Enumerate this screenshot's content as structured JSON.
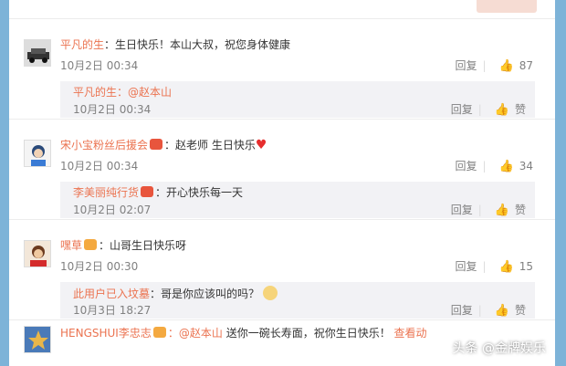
{
  "comments": [
    {
      "user": "平凡的生",
      "text": "：生日快乐！本山大叔，祝您身体健康",
      "date": "10月2日 00:34",
      "reply_label": "回复",
      "likes": "87",
      "reply": {
        "user": "平凡的生",
        "text": "：@赵本山",
        "date": "10月2日 00:34",
        "reply_label": "回复",
        "like_label": "赞"
      }
    },
    {
      "user": "宋小宝粉丝后援会",
      "text": "：赵老师 生日快乐",
      "date": "10月2日 00:34",
      "reply_label": "回复",
      "likes": "34",
      "reply": {
        "user": "李美丽纯行货",
        "text": "：开心快乐每一天",
        "date": "10月2日 02:07",
        "reply_label": "回复",
        "like_label": "赞"
      }
    },
    {
      "user": "嘿草",
      "text": "：山哥生日快乐呀",
      "date": "10月2日 00:30",
      "reply_label": "回复",
      "likes": "15",
      "reply": {
        "user": "此用户已入坟墓",
        "text": "：哥是你应该叫的吗？",
        "date": "10月3日 18:27",
        "reply_label": "回复",
        "like_label": "赞"
      }
    }
  ],
  "last": {
    "user": "HENGSHUI李忠志",
    "mention": "：@赵本山",
    "text": " 送你一碗长寿面，祝你生日快乐！",
    "extra": "查看动"
  },
  "watermark": "头条 @金牌娱乐",
  "colors": {
    "accent": "#eb7350",
    "bg": "#7db3d8"
  }
}
